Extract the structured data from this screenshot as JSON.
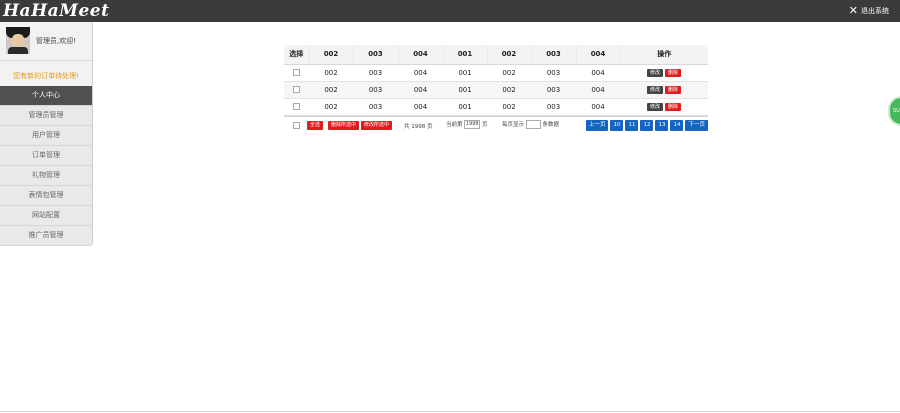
{
  "app": {
    "logo": "HaHaMeet",
    "exit_label": "退出系统"
  },
  "sidebar": {
    "greeting": "管理员,欢迎!",
    "alert": "您有新的订单待处理!",
    "items": [
      {
        "label": "个人中心",
        "active": true
      },
      {
        "label": "管理员管理"
      },
      {
        "label": "用户管理"
      },
      {
        "label": "订单管理"
      },
      {
        "label": "礼物管理"
      },
      {
        "label": "表情包管理"
      },
      {
        "label": "网站配置"
      },
      {
        "label": "推广员管理"
      }
    ]
  },
  "table": {
    "headers": [
      "选择",
      "002",
      "003",
      "004",
      "001",
      "002",
      "003",
      "004",
      "操作"
    ],
    "rows": [
      [
        "002",
        "003",
        "004",
        "001",
        "002",
        "003",
        "004"
      ],
      [
        "002",
        "003",
        "004",
        "001",
        "002",
        "003",
        "004"
      ],
      [
        "002",
        "003",
        "004",
        "001",
        "002",
        "003",
        "004"
      ]
    ],
    "edit_label": "修改",
    "delete_label": "删除"
  },
  "footer": {
    "select_all": "全选",
    "batch_delete": "删除所选中",
    "batch_edit": "修改所选中",
    "total_text": "共 1998 页",
    "current_label": "当前第",
    "current_value": "1998",
    "page_unit": "页",
    "per_page_label": "每页显示",
    "per_page_value": "",
    "per_page_unit": "条数据",
    "pager": [
      "上一页",
      "10",
      "11",
      "12",
      "13",
      "14",
      "下一页"
    ]
  },
  "fab": {
    "label": "SUPP"
  },
  "colors": {
    "topbar": "#3b3b3b",
    "accent_blue": "#1565c0",
    "accent_red": "#e01c1c",
    "alert_orange": "#e39b1b"
  }
}
